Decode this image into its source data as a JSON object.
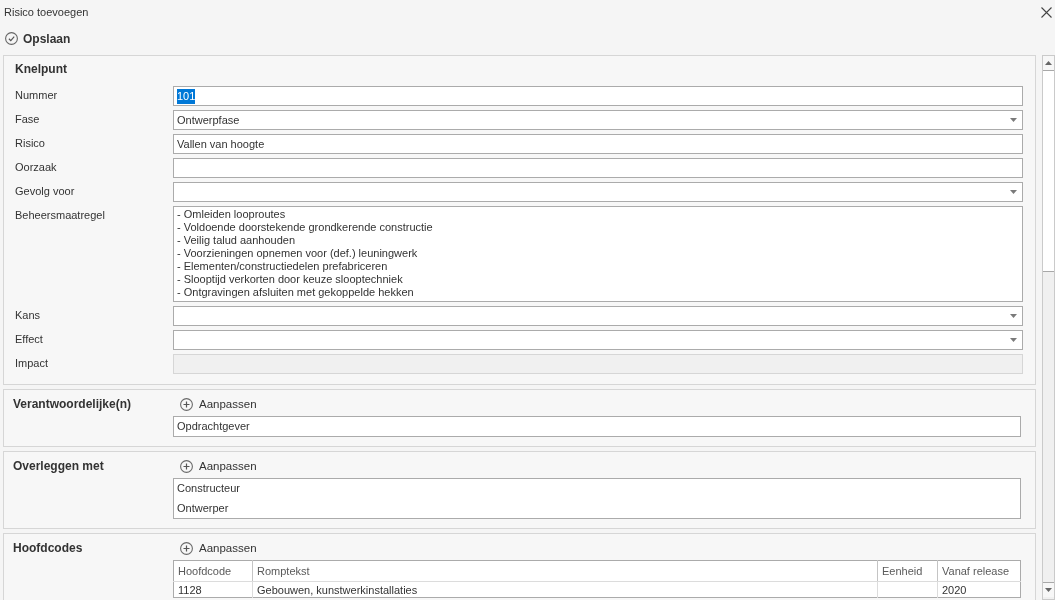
{
  "window": {
    "title": "Risico toevoegen"
  },
  "toolbar": {
    "buttons": [
      {
        "label": "Opslaan"
      }
    ]
  },
  "sections": [
    {
      "kind": "form",
      "title": "Knelpunt",
      "fields": [
        {
          "label": "Nummer",
          "kind": "text",
          "value": "101",
          "text_selected": true,
          "disabled": false
        },
        {
          "label": "Fase",
          "kind": "dropdown",
          "value": "Ontwerpfase",
          "text_selected": false,
          "disabled": false
        },
        {
          "label": "Risico",
          "kind": "text",
          "value": "Vallen van hoogte",
          "text_selected": false,
          "disabled": false
        },
        {
          "label": "Oorzaak",
          "kind": "text",
          "disabled": false
        },
        {
          "label": "Gevolg voor",
          "kind": "dropdown",
          "disabled": false
        },
        {
          "label": "Beheersmaatregel",
          "kind": "textarea",
          "value": "- Omleiden looproutes\n- Voldoende doorstekende grondkerende constructie\n- Veilig talud aanhouden\n- Voorzieningen opnemen voor (def.) leuningwerk\n- Elementen/constructiedelen prefabriceren\n- Slooptijd verkorten door keuze slooptechniek\n- Ontgravingen afsluiten met gekoppelde hekken",
          "text_selected": false,
          "disabled": false
        },
        {
          "label": "Kans",
          "kind": "dropdown",
          "disabled": false
        },
        {
          "label": "Effect",
          "kind": "dropdown",
          "disabled": false
        },
        {
          "label": "Impact",
          "kind": "text",
          "disabled": true
        }
      ]
    },
    {
      "kind": "list",
      "title": "Verantwoordelijke(n)",
      "action": "Aanpassen",
      "items": [
        "Opdrachtgever"
      ]
    },
    {
      "kind": "list",
      "title": "Overleggen met",
      "action": "Aanpassen",
      "items": [
        "Constructeur",
        "Ontwerper"
      ]
    },
    {
      "kind": "table",
      "title": "Hoofdcodes",
      "action": "Aanpassen",
      "columns": [
        "Hoofdcode",
        "Romptekst",
        "Eenheid",
        "Vanaf release"
      ],
      "rows": [
        {
          "hoofdcode": "1128",
          "romptekst": "Gebouwen, kunstwerkinstallaties",
          "vanaf_release": "2020"
        }
      ]
    }
  ]
}
